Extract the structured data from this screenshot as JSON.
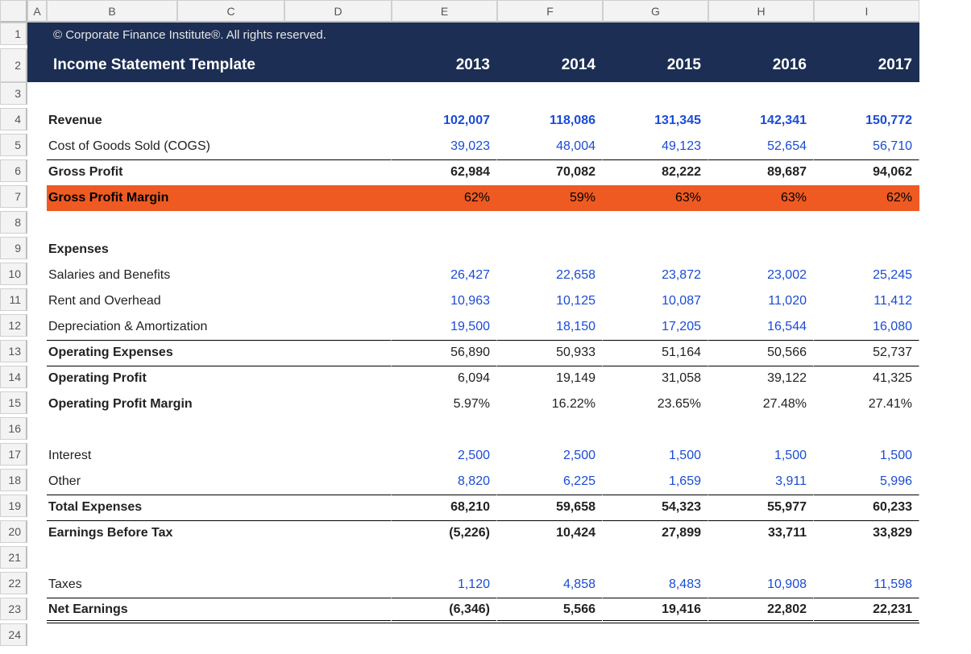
{
  "columns": [
    "A",
    "B",
    "C",
    "D",
    "E",
    "F",
    "G",
    "H",
    "I"
  ],
  "row_numbers": [
    "1",
    "2",
    "3",
    "4",
    "5",
    "6",
    "7",
    "8",
    "9",
    "10",
    "11",
    "12",
    "13",
    "14",
    "15",
    "16",
    "17",
    "18",
    "19",
    "20",
    "21",
    "22",
    "23",
    "24"
  ],
  "header": {
    "copyright": "© Corporate Finance Institute®. All rights reserved.",
    "title": "Income Statement Template",
    "years": [
      "2013",
      "2014",
      "2015",
      "2016",
      "2017"
    ]
  },
  "rows": {
    "revenue": {
      "label": "Revenue",
      "values": [
        "102,007",
        "118,086",
        "131,345",
        "142,341",
        "150,772"
      ]
    },
    "cogs": {
      "label": "Cost of Goods Sold (COGS)",
      "values": [
        "39,023",
        "48,004",
        "49,123",
        "52,654",
        "56,710"
      ]
    },
    "gross_profit": {
      "label": "Gross Profit",
      "values": [
        "62,984",
        "70,082",
        "82,222",
        "89,687",
        "94,062"
      ]
    },
    "gpm": {
      "label": "Gross Profit Margin",
      "values": [
        "62%",
        "59%",
        "63%",
        "63%",
        "62%"
      ]
    },
    "expenses_hdr": {
      "label": "Expenses"
    },
    "salaries": {
      "label": "Salaries and Benefits",
      "values": [
        "26,427",
        "22,658",
        "23,872",
        "23,002",
        "25,245"
      ]
    },
    "rent": {
      "label": "Rent and Overhead",
      "values": [
        "10,963",
        "10,125",
        "10,087",
        "11,020",
        "11,412"
      ]
    },
    "depamort": {
      "label": "Depreciation & Amortization",
      "values": [
        "19,500",
        "18,150",
        "17,205",
        "16,544",
        "16,080"
      ]
    },
    "opex": {
      "label": "Operating Expenses",
      "values": [
        "56,890",
        "50,933",
        "51,164",
        "50,566",
        "52,737"
      ]
    },
    "opprofit": {
      "label": "Operating Profit",
      "values": [
        "6,094",
        "19,149",
        "31,058",
        "39,122",
        "41,325"
      ]
    },
    "opm": {
      "label": "Operating Profit Margin",
      "values": [
        "5.97%",
        "16.22%",
        "23.65%",
        "27.48%",
        "27.41%"
      ]
    },
    "interest": {
      "label": "Interest",
      "values": [
        "2,500",
        "2,500",
        "1,500",
        "1,500",
        "1,500"
      ]
    },
    "other": {
      "label": "Other",
      "values": [
        "8,820",
        "6,225",
        "1,659",
        "3,911",
        "5,996"
      ]
    },
    "total_exp": {
      "label": "Total Expenses",
      "values": [
        "68,210",
        "59,658",
        "54,323",
        "55,977",
        "60,233"
      ]
    },
    "ebt": {
      "label": "Earnings Before Tax",
      "values": [
        "(5,226)",
        "10,424",
        "27,899",
        "33,711",
        "33,829"
      ]
    },
    "taxes": {
      "label": "Taxes",
      "values": [
        "1,120",
        "4,858",
        "8,483",
        "10,908",
        "11,598"
      ]
    },
    "net": {
      "label": "Net Earnings",
      "values": [
        "(6,346)",
        "5,566",
        "19,416",
        "22,802",
        "22,231"
      ]
    }
  },
  "chart_data": {
    "type": "table",
    "title": "Income Statement Template",
    "categories": [
      "2013",
      "2014",
      "2015",
      "2016",
      "2017"
    ],
    "series": [
      {
        "name": "Revenue",
        "values": [
          102007,
          118086,
          131345,
          142341,
          150772
        ]
      },
      {
        "name": "Cost of Goods Sold (COGS)",
        "values": [
          39023,
          48004,
          49123,
          52654,
          56710
        ]
      },
      {
        "name": "Gross Profit",
        "values": [
          62984,
          70082,
          82222,
          89687,
          94062
        ]
      },
      {
        "name": "Gross Profit Margin (%)",
        "values": [
          62,
          59,
          63,
          63,
          62
        ]
      },
      {
        "name": "Salaries and Benefits",
        "values": [
          26427,
          22658,
          23872,
          23002,
          25245
        ]
      },
      {
        "name": "Rent and Overhead",
        "values": [
          10963,
          10125,
          10087,
          11020,
          11412
        ]
      },
      {
        "name": "Depreciation & Amortization",
        "values": [
          19500,
          18150,
          17205,
          16544,
          16080
        ]
      },
      {
        "name": "Operating Expenses",
        "values": [
          56890,
          50933,
          51164,
          50566,
          52737
        ]
      },
      {
        "name": "Operating Profit",
        "values": [
          6094,
          19149,
          31058,
          39122,
          41325
        ]
      },
      {
        "name": "Operating Profit Margin (%)",
        "values": [
          5.97,
          16.22,
          23.65,
          27.48,
          27.41
        ]
      },
      {
        "name": "Interest",
        "values": [
          2500,
          2500,
          1500,
          1500,
          1500
        ]
      },
      {
        "name": "Other",
        "values": [
          8820,
          6225,
          1659,
          3911,
          5996
        ]
      },
      {
        "name": "Total Expenses",
        "values": [
          68210,
          59658,
          54323,
          55977,
          60233
        ]
      },
      {
        "name": "Earnings Before Tax",
        "values": [
          -5226,
          10424,
          27899,
          33711,
          33829
        ]
      },
      {
        "name": "Taxes",
        "values": [
          1120,
          4858,
          8483,
          10908,
          11598
        ]
      },
      {
        "name": "Net Earnings",
        "values": [
          -6346,
          5566,
          19416,
          22802,
          22231
        ]
      }
    ]
  }
}
